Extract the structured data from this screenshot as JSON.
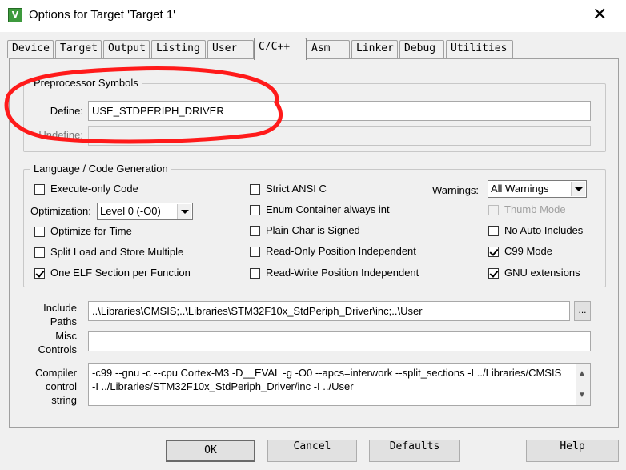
{
  "window": {
    "title": "Options for Target 'Target 1'",
    "close_glyph": "✕"
  },
  "tabs": [
    {
      "label": "Device"
    },
    {
      "label": "Target"
    },
    {
      "label": "Output"
    },
    {
      "label": "Listing"
    },
    {
      "label": "User"
    },
    {
      "label": "C/C++"
    },
    {
      "label": "Asm"
    },
    {
      "label": "Linker"
    },
    {
      "label": "Debug"
    },
    {
      "label": "Utilities"
    }
  ],
  "active_tab": "C/C++",
  "preprocessor": {
    "title": "Preprocessor Symbols",
    "define_label": "Define:",
    "define_value": "USE_STDPERIPH_DRIVER",
    "undefine_label": "Undefine:",
    "undefine_value": ""
  },
  "language": {
    "title": "Language / Code Generation",
    "execute_only": {
      "label": "Execute-only Code",
      "checked": false
    },
    "optimization_label": "Optimization:",
    "optimization_value": "Level 0 (-O0)",
    "optimize_time": {
      "label": "Optimize for Time",
      "checked": false
    },
    "split_load": {
      "label": "Split Load and Store Multiple",
      "checked": false
    },
    "one_elf": {
      "label": "One ELF Section per Function",
      "checked": true
    },
    "strict_ansi": {
      "label": "Strict ANSI C",
      "checked": false
    },
    "enum_int": {
      "label": "Enum Container always int",
      "checked": false
    },
    "plain_char": {
      "label": "Plain Char is Signed",
      "checked": false
    },
    "ro_pi": {
      "label": "Read-Only Position Independent",
      "checked": false
    },
    "rw_pi": {
      "label": "Read-Write Position Independent",
      "checked": false
    },
    "warnings_label": "Warnings:",
    "warnings_value": "All Warnings",
    "thumb_mode": {
      "label": "Thumb Mode",
      "checked": false,
      "disabled": true
    },
    "no_auto_includes": {
      "label": "No Auto Includes",
      "checked": false
    },
    "c99": {
      "label": "C99 Mode",
      "checked": true
    },
    "gnu_ext": {
      "label": "GNU extensions",
      "checked": true
    }
  },
  "include": {
    "label_1": "Include",
    "label_2": "Paths",
    "value": "..\\Libraries\\CMSIS;..\\Libraries\\STM32F10x_StdPeriph_Driver\\inc;..\\User",
    "browse_label": "..."
  },
  "misc": {
    "label_1": "Misc",
    "label_2": "Controls",
    "value": ""
  },
  "compiler": {
    "label_1": "Compiler",
    "label_2": "control",
    "label_3": "string",
    "line_1": "-c99 --gnu -c --cpu Cortex-M3 -D__EVAL -g -O0 --apcs=interwork --split_sections -I ../Libraries/CMSIS",
    "line_2": "-I ../Libraries/STM32F10x_StdPeriph_Driver/inc -I ../User"
  },
  "buttons": {
    "ok": "OK",
    "cancel": "Cancel",
    "defaults": "Defaults",
    "help": "Help"
  },
  "colors": {
    "annotation": "#ff1a1a",
    "app_icon": "#3d9a3d"
  }
}
